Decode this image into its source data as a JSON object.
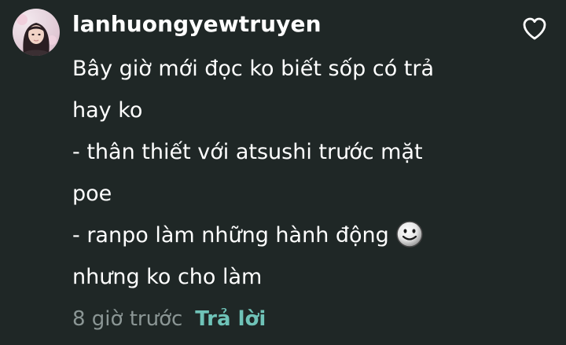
{
  "comment": {
    "username": "lanhuongyewtruyen",
    "lines": [
      "Bây giờ mới đọc ko biết sốp có trả",
      "hay ko",
      " - thân thiết với atsushi trước mặt",
      "poe",
      "  -  ranpo làm những hành động",
      "nhưng ko cho làm"
    ],
    "emoji": "smirk-face-emoji",
    "time": "8 giờ trước",
    "reply_label": "Trả lời"
  },
  "icons": {
    "like": "heart-outline-icon"
  },
  "colors": {
    "background": "#1f2726",
    "text": "#ffffff",
    "muted": "#8b9695",
    "accent": "#6fc3b8"
  }
}
